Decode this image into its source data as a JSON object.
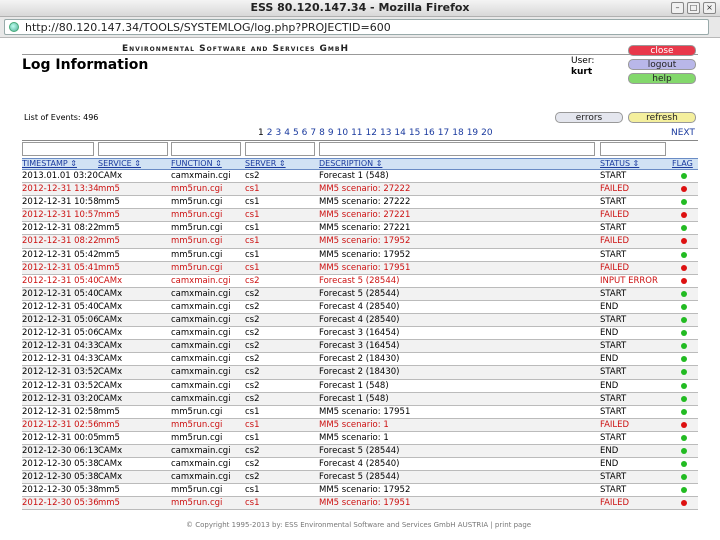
{
  "window": {
    "title": "ESS 80.120.147.34 - Mozilla Firefox"
  },
  "browser": {
    "url": "http://80.120.147.34/TOOLS/SYSTEMLOG/log.php?PROJECTID=600"
  },
  "header": {
    "company": "Environmental Software and Services GmbH",
    "title": "Log Information",
    "user_label": "User:",
    "user_name": "kurt"
  },
  "buttons": {
    "close": "close",
    "logout": "logout",
    "help": "help",
    "errors": "errors",
    "refresh": "refresh"
  },
  "events_label": "List of Events: 496",
  "pager": {
    "pages": [
      "1",
      "2",
      "3",
      "4",
      "5",
      "6",
      "7",
      "8",
      "9",
      "10",
      "11",
      "12",
      "13",
      "14",
      "15",
      "16",
      "17",
      "18",
      "19",
      "20"
    ],
    "current": "1",
    "next": "NEXT"
  },
  "columns": [
    "TIMESTAMP ⇕",
    "SERVICE ⇕",
    "FUNCTION ⇕",
    "SERVER ⇕",
    "DESCRIPTION ⇕",
    "STATUS ⇕",
    "FLAG"
  ],
  "colors": {
    "ok": "#22bb22",
    "fail": "#dd1111",
    "header_bg": "#d1e2f4"
  },
  "rows": [
    [
      "2013.01.01 03:20",
      "CAMx",
      "camxmain.cgi",
      "cs2",
      "Forecast 1 (548)",
      "START",
      "ok"
    ],
    [
      "2012-12-31 13:34",
      "mm5",
      "mm5run.cgi",
      "cs1",
      "MM5 scenario: 27222",
      "FAILED",
      "fail"
    ],
    [
      "2012-12-31 10:58",
      "mm5",
      "mm5run.cgi",
      "cs1",
      "MM5 scenario: 27222",
      "START",
      "ok"
    ],
    [
      "2012-12-31 10:57",
      "mm5",
      "mm5run.cgi",
      "cs1",
      "MM5 scenario: 27221",
      "FAILED",
      "fail"
    ],
    [
      "2012-12-31 08:22",
      "mm5",
      "mm5run.cgi",
      "cs1",
      "MM5 scenario: 27221",
      "START",
      "ok"
    ],
    [
      "2012-12-31 08:22",
      "mm5",
      "mm5run.cgi",
      "cs1",
      "MM5 scenario: 17952",
      "FAILED",
      "fail"
    ],
    [
      "2012-12-31 05:42",
      "mm5",
      "mm5run.cgi",
      "cs1",
      "MM5 scenario: 17952",
      "START",
      "ok"
    ],
    [
      "2012-12-31 05:41",
      "mm5",
      "mm5run.cgi",
      "cs1",
      "MM5 scenario: 17951",
      "FAILED",
      "fail"
    ],
    [
      "2012-12-31 05:40",
      "CAMx",
      "camxmain.cgi",
      "cs2",
      "Forecast 5 (28544)",
      "INPUT ERROR",
      "fail"
    ],
    [
      "2012-12-31 05:40",
      "CAMx",
      "camxmain.cgi",
      "cs2",
      "Forecast 5 (28544)",
      "START",
      "ok"
    ],
    [
      "2012-12-31 05:40",
      "CAMx",
      "camxmain.cgi",
      "cs2",
      "Forecast 4 (28540)",
      "END",
      "ok"
    ],
    [
      "2012-12-31 05:06",
      "CAMx",
      "camxmain.cgi",
      "cs2",
      "Forecast 4 (28540)",
      "START",
      "ok"
    ],
    [
      "2012-12-31 05:06",
      "CAMx",
      "camxmain.cgi",
      "cs2",
      "Forecast 3 (16454)",
      "END",
      "ok"
    ],
    [
      "2012-12-31 04:33",
      "CAMx",
      "camxmain.cgi",
      "cs2",
      "Forecast 3 (16454)",
      "START",
      "ok"
    ],
    [
      "2012-12-31 04:33",
      "CAMx",
      "camxmain.cgi",
      "cs2",
      "Forecast 2 (18430)",
      "END",
      "ok"
    ],
    [
      "2012-12-31 03:52",
      "CAMx",
      "camxmain.cgi",
      "cs2",
      "Forecast 2 (18430)",
      "START",
      "ok"
    ],
    [
      "2012-12-31 03:52",
      "CAMx",
      "camxmain.cgi",
      "cs2",
      "Forecast 1 (548)",
      "END",
      "ok"
    ],
    [
      "2012-12-31 03:20",
      "CAMx",
      "camxmain.cgi",
      "cs2",
      "Forecast 1 (548)",
      "START",
      "ok"
    ],
    [
      "2012-12-31 02:58",
      "mm5",
      "mm5run.cgi",
      "cs1",
      "MM5 scenario: 17951",
      "START",
      "ok"
    ],
    [
      "2012-12-31 02:56",
      "mm5",
      "mm5run.cgi",
      "cs1",
      "MM5 scenario: 1",
      "FAILED",
      "fail"
    ],
    [
      "2012-12-31 00:05",
      "mm5",
      "mm5run.cgi",
      "cs1",
      "MM5 scenario: 1",
      "START",
      "ok"
    ],
    [
      "2012-12-30 06:13",
      "CAMx",
      "camxmain.cgi",
      "cs2",
      "Forecast 5 (28544)",
      "END",
      "ok"
    ],
    [
      "2012-12-30 05:38",
      "CAMx",
      "camxmain.cgi",
      "cs2",
      "Forecast 4 (28540)",
      "END",
      "ok"
    ],
    [
      "2012-12-30 05:38",
      "CAMx",
      "camxmain.cgi",
      "cs2",
      "Forecast 5 (28544)",
      "START",
      "ok"
    ],
    [
      "2012-12-30 05:38",
      "mm5",
      "mm5run.cgi",
      "cs1",
      "MM5 scenario: 17952",
      "START",
      "ok"
    ],
    [
      "2012-12-30 05:36",
      "mm5",
      "mm5run.cgi",
      "cs1",
      "MM5 scenario: 17951",
      "FAILED",
      "fail"
    ]
  ],
  "footer": "© Copyright 1995-2013 by: ESS Environmental Software and Services GmbH AUSTRIA | print page"
}
